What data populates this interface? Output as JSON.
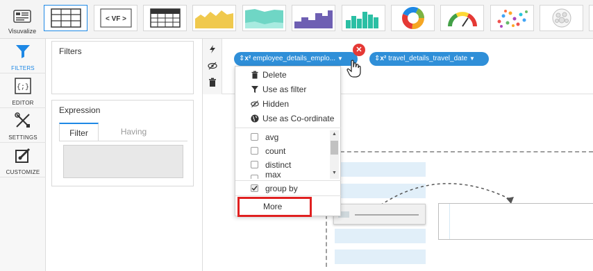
{
  "toolbar": {
    "visualize_label": "Visuvalize",
    "vf_label": "< VF >",
    "items": [
      {
        "name": "table-chart"
      },
      {
        "name": "vf-chart"
      },
      {
        "name": "pivot-table"
      },
      {
        "name": "area-chart"
      },
      {
        "name": "stacked-area-chart"
      },
      {
        "name": "step-bar-chart"
      },
      {
        "name": "histogram-chart"
      },
      {
        "name": "donut-chart"
      },
      {
        "name": "gauge-chart"
      },
      {
        "name": "scatter-chart"
      },
      {
        "name": "bubble-cluster-chart"
      }
    ]
  },
  "sidebar": {
    "items": [
      {
        "label": "FILTERS",
        "icon": "filter-icon"
      },
      {
        "label": "EDITOR",
        "icon": "code-braces-icon"
      },
      {
        "label": "SETTINGS",
        "icon": "wrench-screwdriver-icon"
      },
      {
        "label": "CUSTOMIZE",
        "icon": "paint-brush-icon"
      }
    ]
  },
  "filters_panel": {
    "title": "Filters"
  },
  "expression_panel": {
    "title": "Expression",
    "tabs": [
      {
        "label": "Filter",
        "active": true
      },
      {
        "label": "Having",
        "active": false
      }
    ],
    "value": ""
  },
  "fields": [
    {
      "label": "employee_details_emplo...",
      "icon": "sort-arrows-icon",
      "badge": "x²"
    },
    {
      "label": "travel_details_travel_date",
      "icon": "sort-arrows-icon",
      "badge": "x²"
    }
  ],
  "context_menu": {
    "actions": [
      {
        "label": "Delete",
        "icon": "trash-icon"
      },
      {
        "label": "Use as filter",
        "icon": "filter-icon"
      },
      {
        "label": "Hidden",
        "icon": "eye-slash-icon"
      },
      {
        "label": "Use as Co-ordinate",
        "icon": "globe-icon"
      }
    ],
    "aggregations": [
      {
        "label": "avg",
        "checked": false
      },
      {
        "label": "count",
        "checked": false
      },
      {
        "label": "distinct",
        "checked": false
      },
      {
        "label": "max",
        "checked": false
      }
    ],
    "group_by": {
      "label": "group by",
      "checked": true
    },
    "more_label": "More"
  },
  "colors": {
    "accent": "#1e88e5",
    "pill": "#2f8fd8",
    "highlight": "#e02020",
    "delete_badge": "#e53935"
  }
}
